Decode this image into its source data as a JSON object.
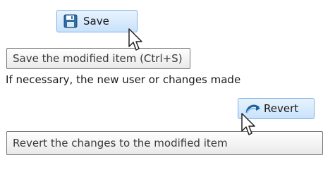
{
  "save_button": {
    "label": "Save",
    "icon": "floppy-disk-icon"
  },
  "save_tooltip": {
    "text": "Save the modified item (Ctrl+S)"
  },
  "description": {
    "text": "If necessary, the new user or changes made"
  },
  "revert_button": {
    "label": "Revert",
    "icon": "revert-arrow-icon"
  },
  "revert_tooltip": {
    "text": "Revert the changes to the modified item"
  },
  "colors": {
    "button_border": "#7fb2e6",
    "button_fill": "#c9e2fb",
    "tooltip_border": "#777777"
  }
}
